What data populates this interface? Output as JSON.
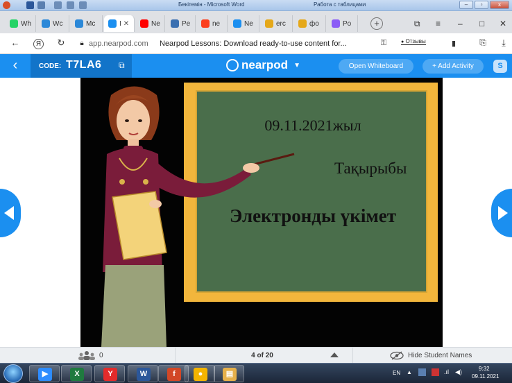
{
  "office": {
    "word_title": "Бекітемін - Microsoft Word",
    "tables_tab": "Работа с таблицами"
  },
  "browser": {
    "tabs": [
      {
        "label": "Wh",
        "icon": "whatsapp-icon",
        "color": "#25d366"
      },
      {
        "label": "Wc",
        "icon": "windows-grid-icon",
        "color": "#2b88d8"
      },
      {
        "label": "Mc",
        "icon": "windows-grid-icon",
        "color": "#2b88d8"
      },
      {
        "label": "I",
        "icon": "nearpod-icon",
        "color": "#1b8ff0",
        "active": true
      },
      {
        "label": "Ne",
        "icon": "youtube-icon",
        "color": "#ff0000"
      },
      {
        "label": "Pe",
        "icon": "browser-icon",
        "color": "#3a6fb0"
      },
      {
        "label": "ne",
        "icon": "yandex-icon",
        "color": "#fc3f1d"
      },
      {
        "label": "Ne",
        "icon": "nearpod-icon",
        "color": "#1b8ff0"
      },
      {
        "label": "erc",
        "icon": "image-icon",
        "color": "#e5a81a"
      },
      {
        "label": "фо",
        "icon": "image-icon",
        "color": "#e5a81a"
      },
      {
        "label": "Po",
        "icon": "powerpoint-icon",
        "color": "#8b5cf6"
      }
    ],
    "url_domain": "app.nearpod.com",
    "url_title": "Nearpod Lessons: Download ready-to-use content for...",
    "feedback_label": "Отзывы"
  },
  "nearpod": {
    "code_label": "CODE:",
    "code_value": "T7LA6",
    "logo_text": "nearpod",
    "open_whiteboard": "Open Whiteboard",
    "add_activity": "+ Add Activity",
    "avatar_letter": "S"
  },
  "slide": {
    "date_text": "09.11.2021жыл",
    "topic_label": "Тақырыбы",
    "topic_title": "Электронды үкімет"
  },
  "bottom_bar": {
    "students_count": "0",
    "page_indicator": "4 of 20",
    "hide_names": "Hide Student Names"
  },
  "taskbar": {
    "language": "EN",
    "time": "9:32",
    "date": "09.11.2021",
    "apps": [
      {
        "name": "zoom",
        "color": "#2d8cff",
        "glyph": "▶"
      },
      {
        "name": "excel",
        "color": "#1f7a3f",
        "glyph": "X"
      },
      {
        "name": "yandex-browser",
        "color": "#e32b2b",
        "glyph": "Y"
      },
      {
        "name": "word",
        "color": "#2b579a",
        "glyph": "W"
      },
      {
        "name": "flash-player",
        "color": "#d24726",
        "glyph": "f"
      },
      {
        "name": "chrome",
        "color": "#f4b400",
        "glyph": "●"
      },
      {
        "name": "file-explorer",
        "color": "#e6b04a",
        "glyph": "▤"
      }
    ]
  }
}
